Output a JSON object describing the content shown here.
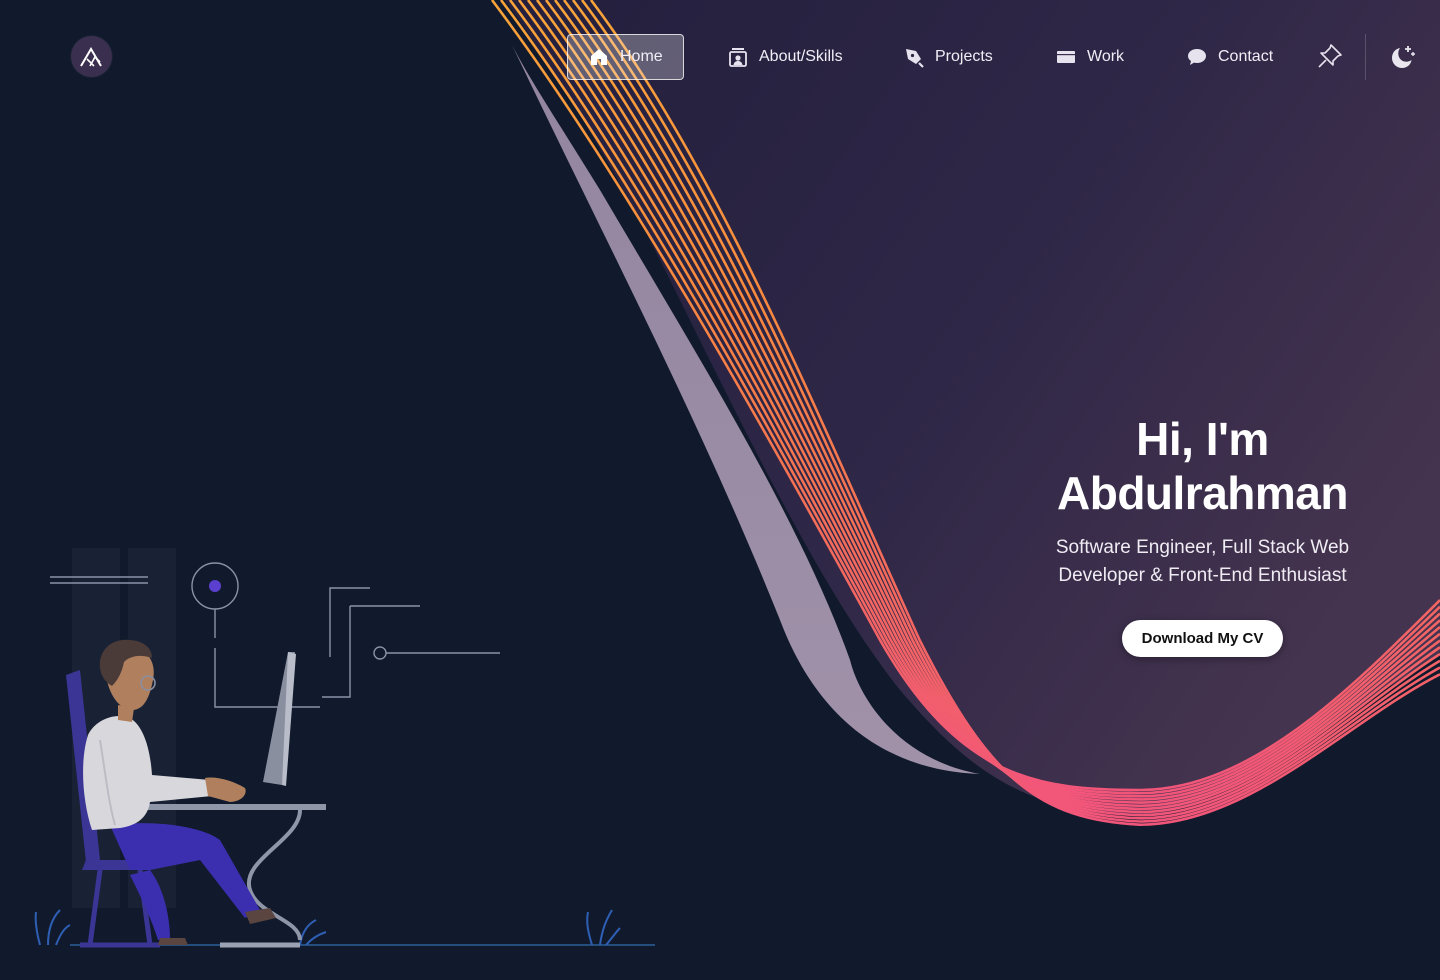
{
  "brand": {
    "logo_icon": "mountain-logo-icon"
  },
  "nav": {
    "items": [
      {
        "label": "Home",
        "icon": "home-icon",
        "active": true
      },
      {
        "label": "About/Skills",
        "icon": "user-badge-icon",
        "active": false
      },
      {
        "label": "Projects",
        "icon": "pen-tool-icon",
        "active": false
      },
      {
        "label": "Work",
        "icon": "monitor-icon",
        "active": false
      },
      {
        "label": "Contact",
        "icon": "chat-bubble-icon",
        "active": false
      }
    ],
    "pin_icon": "pin-icon",
    "theme_icon": "moon-stars-icon"
  },
  "hero": {
    "title_line1": "Hi, I'm",
    "title_line2": "Abdulrahman",
    "subtitle_line1": "Software Engineer, Full Stack Web",
    "subtitle_line2": "Developer & Front-End Enthusiast",
    "cta_label": "Download My CV"
  },
  "colors": {
    "background": "#101a2c",
    "panel_purple": "#3a2d4e",
    "wave_orange": "#f7a33a",
    "wave_pink": "#f25a7a",
    "accent_violet": "#5b3fcf"
  }
}
